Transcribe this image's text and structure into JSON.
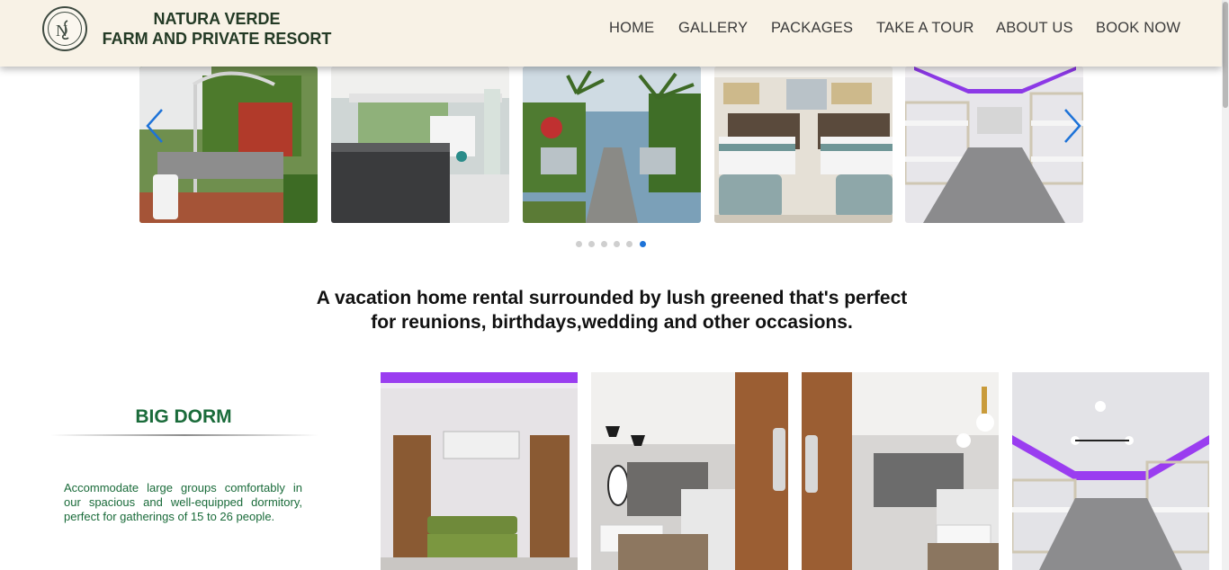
{
  "header": {
    "brand_line1": "NATURA VERDE",
    "brand_line2": "FARM AND PRIVATE RESORT",
    "logo_icon": "ns-monogram-logo",
    "nav": [
      {
        "label": "HOME"
      },
      {
        "label": "GALLERY"
      },
      {
        "label": "PACKAGES"
      },
      {
        "label": "TAKE A TOUR"
      },
      {
        "label": "ABOUT US"
      },
      {
        "label": "BOOK NOW"
      }
    ]
  },
  "carousel": {
    "slides": [
      {
        "subject": "outdoor grill and garden"
      },
      {
        "subject": "outdoor kitchen pavilion"
      },
      {
        "subject": "garden pathway with palms"
      },
      {
        "subject": "twin bedroom"
      },
      {
        "subject": "bunk bed dormitory"
      }
    ],
    "dot_count": 6,
    "active_dot": 6,
    "accent_color": "#1e73d8"
  },
  "tagline": {
    "line1": "A vacation home rental surrounded by lush greened that's perfect",
    "line2": "for reunions, birthdays,wedding and other occasions."
  },
  "room": {
    "title": "BIG DORM",
    "description": "Accommodate large groups comfortably in our spacious and well-equipped dormitory, perfect for gatherings of 15 to 26 people.",
    "title_color": "#1a6b3a"
  }
}
